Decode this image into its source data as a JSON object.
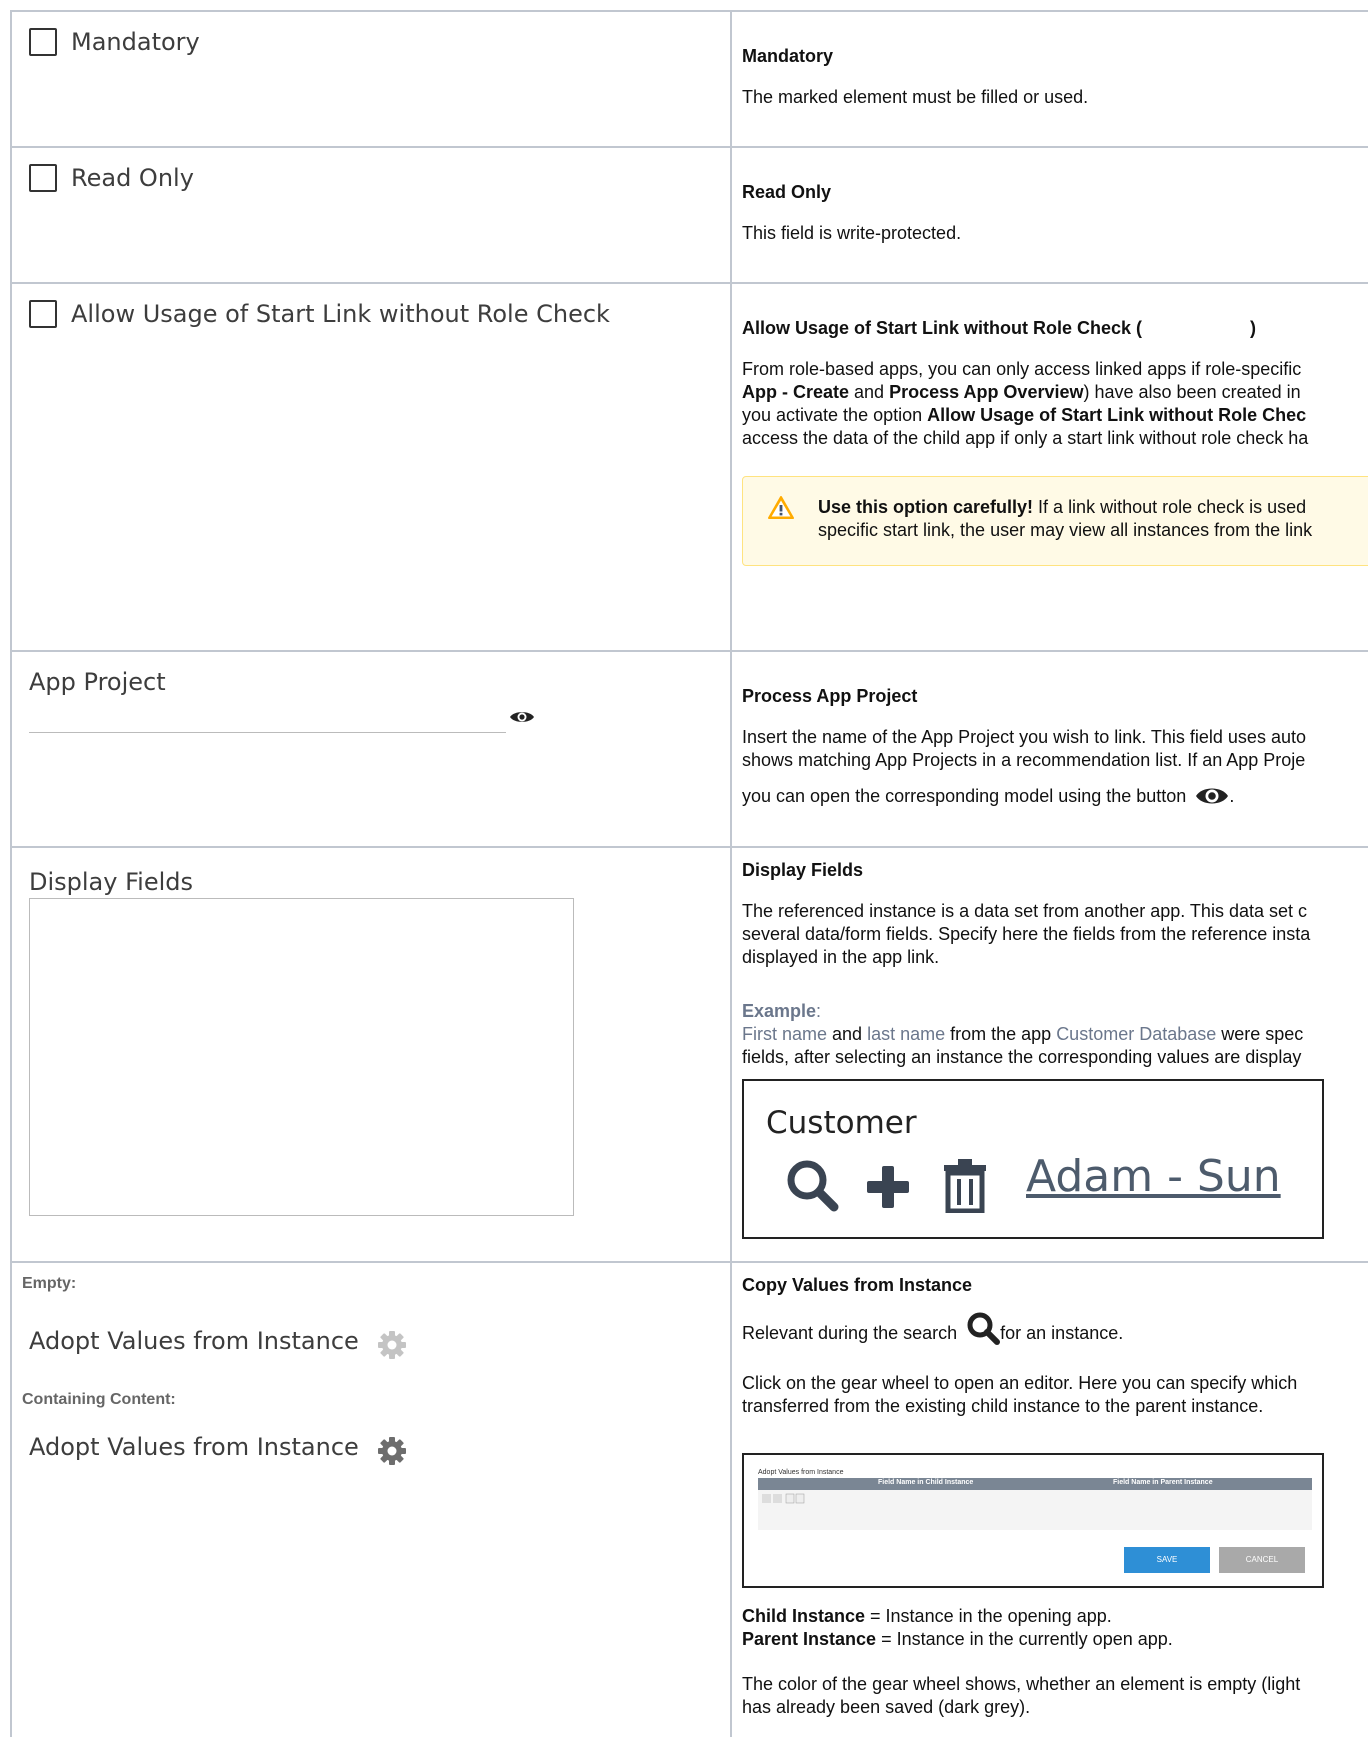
{
  "row1": {
    "checkbox_label": "Mandatory",
    "title": "Mandatory",
    "desc": "The marked element must be filled or used."
  },
  "row2": {
    "checkbox_label": "Read Only",
    "title": "Read Only",
    "desc": "This field is write-protected."
  },
  "row3": {
    "checkbox_label": "Allow Usage of Start Link without Role Check",
    "title": "Allow Usage of Start Link without Role Check (",
    "title_close": ")",
    "p1_a": "From role-based apps, you can only access linked apps if role-specific",
    "p2_b1": "App - Create",
    "p2_t1": " and ",
    "p2_b2": "Process App Overview",
    "p2_t2": ") have also been created in",
    "p3_t1": "you activate the option ",
    "p3_b1": "Allow Usage of Start Link without Role Chec",
    "p4": "access the data of the child app if only a start link without role check ha",
    "warn_bold": "Use this option carefully!",
    "warn_t1": " If a link without role check is used",
    "warn_t2": "specific start link, the user may view all instances from the link"
  },
  "row4": {
    "field_label": "App Project",
    "title": "Process App Project",
    "l1": "Insert the name of the App Project you wish to link. This field uses auto",
    "l2": "shows matching App Projects in a recommendation list. If an App Proje",
    "l3": "you can open the corresponding model using the button",
    "l3_end": "."
  },
  "row5": {
    "field_label": "Display Fields",
    "title": "Display Fields",
    "l1": "The referenced instance is a data set from another app. This data set c",
    "l2": "several data/form fields. Specify here the fields from the reference insta",
    "l3": "displayed in the app link.",
    "example_label": "Example",
    "example_colon": ":",
    "ex_first": "First name",
    "ex_and": " and ",
    "ex_last": "last name",
    "ex_from": " from the app ",
    "ex_db": "Customer Database",
    "ex_were": " were spec",
    "ex_l2": "fields, after selecting an instance the corresponding values are display",
    "customer_label": "Customer",
    "customer_value": "Adam - Sun"
  },
  "row6": {
    "empty_label": "Empty:",
    "adopt_label": "Adopt Values from Instance",
    "containing_label": "Containing Content:",
    "adopt_label2": "Adopt Values from Instance",
    "title": "Copy Values from Instance",
    "relevant_a": "Relevant during the search",
    "relevant_b": "for an instance.",
    "click_l1": "Click on the gear wheel to open an editor. Here you can specify which",
    "click_l2": "transferred from the existing child instance to the parent instance.",
    "editor": {
      "title": "Adopt Values from Instance",
      "col1": "Field Name in Child Instance",
      "col2": "Field Name in Parent Instance",
      "save": "SAVE",
      "cancel": "CANCEL"
    },
    "child_b": "Child Instance",
    "child_t": " = Instance in the opening app.",
    "parent_b": "Parent Instance",
    "parent_t": " = Instance in the currently open app.",
    "color_l1": "The color of the gear wheel shows, whether an element is empty (light",
    "color_l2": "has already been saved (dark grey)."
  },
  "colors": {
    "border": "#c1c7d0",
    "warning_bg": "#fffae6",
    "warning_border": "#ffe380",
    "gear_light": "#c4c4c4",
    "gear_dark": "#6d6d6d",
    "link_grey": "#6b778c",
    "save_blue": "#2e8fd6"
  }
}
